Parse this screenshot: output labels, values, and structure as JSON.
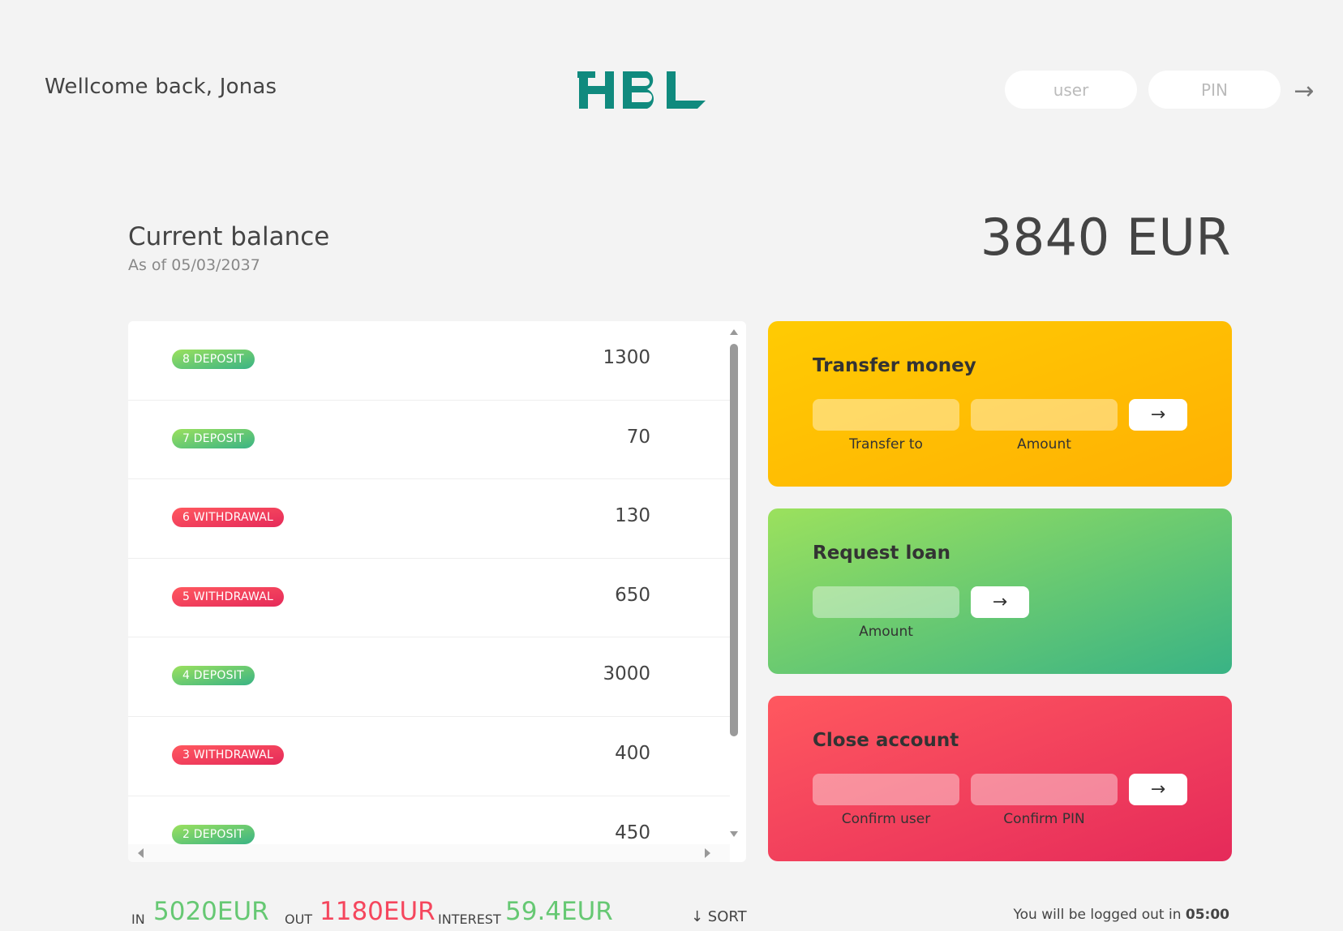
{
  "nav": {
    "welcome": "Wellcome back, Jonas",
    "logo_text": "HBL",
    "user_placeholder": "user",
    "pin_placeholder": "PIN",
    "login_arrow": "→"
  },
  "balance": {
    "label": "Current balance",
    "date": "As of 05/03/2037",
    "value": "3840 EUR"
  },
  "movements": [
    {
      "type": "deposit",
      "label": "8 deposit",
      "value": "1300"
    },
    {
      "type": "deposit",
      "label": "7 deposit",
      "value": "70"
    },
    {
      "type": "withdrawal",
      "label": "6 withdrawal",
      "value": "130"
    },
    {
      "type": "withdrawal",
      "label": "5 withdrawal",
      "value": "650"
    },
    {
      "type": "deposit",
      "label": "4 deposit",
      "value": "3000"
    },
    {
      "type": "withdrawal",
      "label": "3 withdrawal",
      "value": "400"
    },
    {
      "type": "deposit",
      "label": "2 deposit",
      "value": "450"
    }
  ],
  "operations": {
    "transfer": {
      "title": "Transfer money",
      "label_to": "Transfer to",
      "label_amount": "Amount",
      "button": "→"
    },
    "loan": {
      "title": "Request loan",
      "label_amount": "Amount",
      "button": "→"
    },
    "close": {
      "title": "Close account",
      "label_user": "Confirm user",
      "label_pin": "Confirm PIN",
      "button": "→"
    }
  },
  "summary": {
    "in_label": "In",
    "in_value": "5020EUR",
    "out_label": "Out",
    "out_value": "1180EUR",
    "interest_label": "Interest",
    "interest_value": "59.4EUR",
    "sort": "↓ SORT"
  },
  "logout": {
    "text": "You will be logged out in ",
    "time": "05:00"
  },
  "colors": {
    "brand": "#108a7e",
    "deposit": "#66c873",
    "withdrawal": "#f5465d",
    "transfer_bg": "#ffb003",
    "loan_bg": "#39b385",
    "close_bg": "#e52a5a"
  }
}
